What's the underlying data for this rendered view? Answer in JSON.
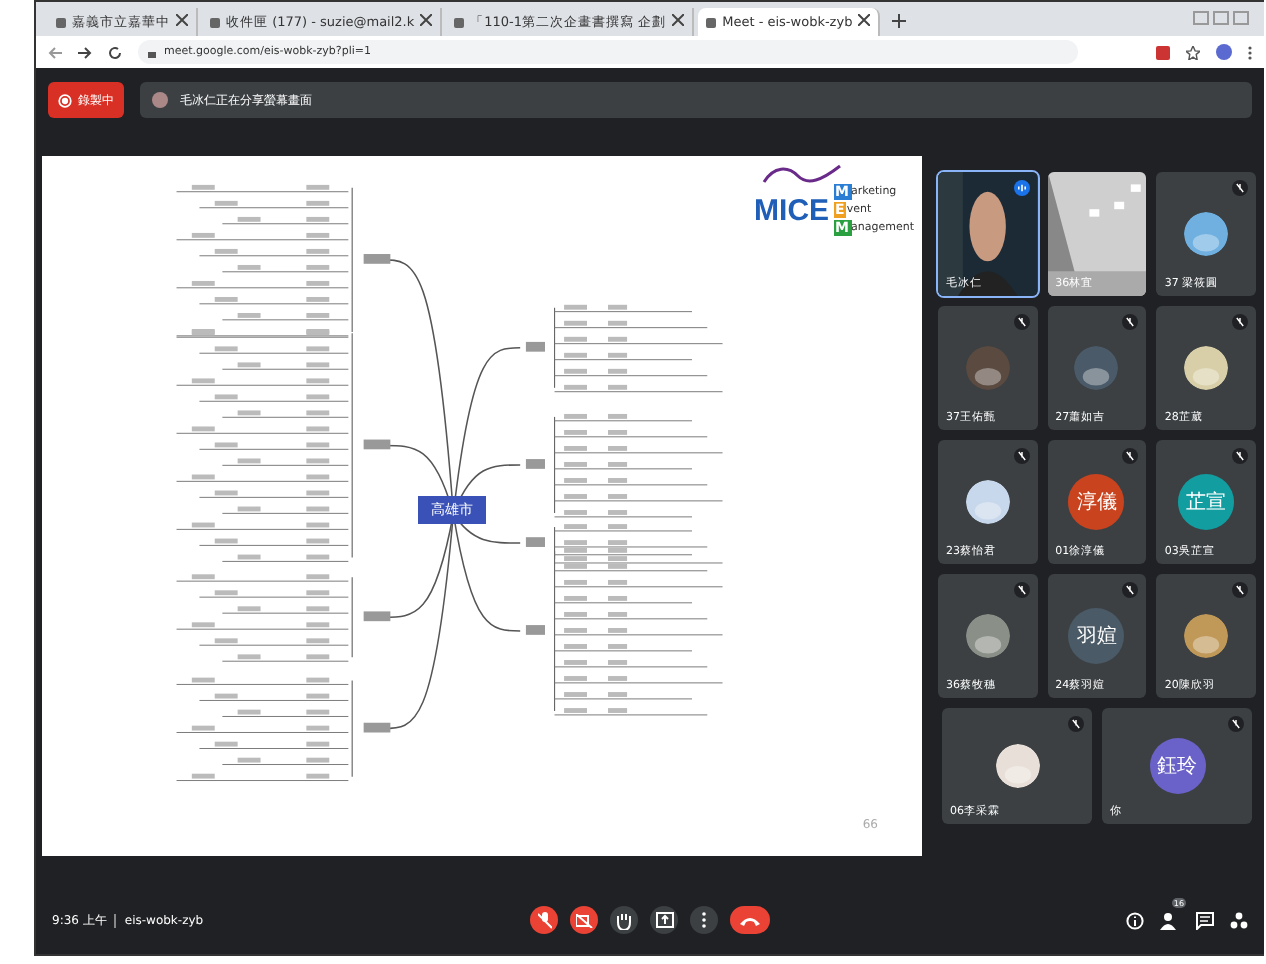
{
  "browser": {
    "tabs": [
      {
        "title": "嘉義市立嘉華中",
        "selected": false
      },
      {
        "title": "收件匣 (177) - suzie@mail2.k",
        "selected": false
      },
      {
        "title": "「110-1第二次企畫書撰寫 企劃",
        "selected": false
      },
      {
        "title": "Meet - eis-wobk-zyb",
        "selected": true
      }
    ],
    "url": "meet.google.com/eis-wobk-zyb?pli=1"
  },
  "meet": {
    "recording_label": "錄製中",
    "presenter_banner": "毛冰仁正在分享螢幕畫面",
    "slide": {
      "central_topic": "高雄市",
      "logo": {
        "main": "MICE",
        "lines": [
          {
            "initial": "M",
            "rest": "arketing",
            "color": "#2a7fd4"
          },
          {
            "initial": "E",
            "rest": "vent",
            "color": "#f0a020"
          },
          {
            "initial": "M",
            "rest": "anagement",
            "color": "#2aa040"
          }
        ]
      },
      "page_number": "66"
    },
    "participants": [
      {
        "name": "毛冰仁",
        "kind": "video",
        "speaking": true
      },
      {
        "name": "36林宜",
        "kind": "video",
        "speaking": false
      },
      {
        "name": "37 梁筱圓",
        "kind": "picture",
        "color": "#6fb0e0",
        "speaking": false
      },
      {
        "name": "37王佑甄",
        "kind": "picture",
        "color": "#5a4a40",
        "speaking": false
      },
      {
        "name": "27蕭如吉",
        "kind": "picture",
        "color": "#4a5a68",
        "speaking": false
      },
      {
        "name": "28芷葳",
        "kind": "picture",
        "color": "#d8cfa8",
        "speaking": false
      },
      {
        "name": "23蔡怡君",
        "kind": "picture",
        "color": "#c8d8ec",
        "speaking": false
      },
      {
        "name": "01徐淳儀",
        "kind": "letter",
        "initials": "淳儀",
        "color": "#c9431e",
        "speaking": false
      },
      {
        "name": "03吳芷宣",
        "kind": "letter",
        "initials": "芷宣",
        "color": "#129ea0",
        "speaking": false
      },
      {
        "name": "36蔡牧穗",
        "kind": "picture",
        "color": "#8a9088",
        "speaking": false
      },
      {
        "name": "24蔡羽媗",
        "kind": "letter",
        "initials": "羽媗",
        "color": "#4a5a66",
        "speaking": false
      },
      {
        "name": "20陳欣羽",
        "kind": "picture",
        "color": "#c09858",
        "speaking": false
      },
      {
        "name": "06李采霖",
        "kind": "picture",
        "color": "#e8e0d8",
        "speaking": false
      },
      {
        "name": "你",
        "kind": "letter",
        "initials": "鈺玲",
        "color": "#6a62c8",
        "speaking": false
      }
    ],
    "time": "9:36 上午",
    "meeting_code": "eis-wobk-zyb",
    "participant_count": "16"
  }
}
